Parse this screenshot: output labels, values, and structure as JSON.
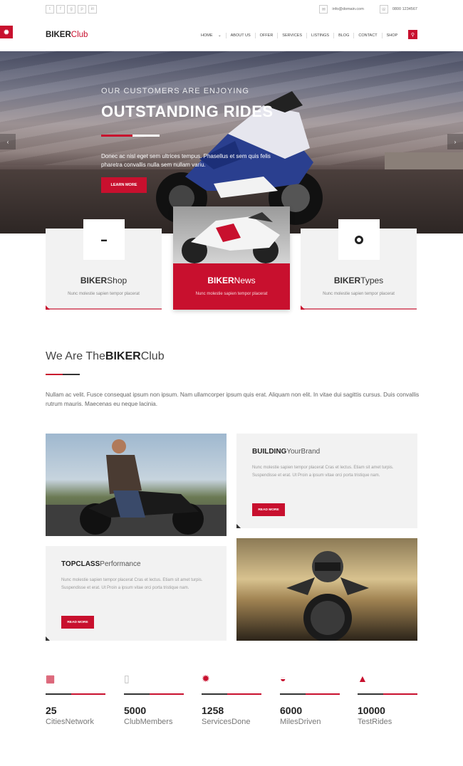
{
  "topbar": {
    "social_icons": [
      "twitter-icon",
      "facebook-icon",
      "google-plus-icon",
      "pinterest-icon",
      "linkedin-icon"
    ],
    "social_glyphs": [
      "t",
      "f",
      "g",
      "p",
      "in"
    ],
    "email": "info@domain.com",
    "phone": "0800 1234567"
  },
  "header": {
    "logo_bold": "BIKER",
    "logo_light": "Club",
    "nav": [
      "HOME",
      "ABOUT US",
      "OFFER",
      "SERVICES",
      "LISTINGS",
      "BLOG",
      "CONTACT",
      "SHOP"
    ]
  },
  "hero": {
    "subtitle": "OUR CUSTOMERS ARE ENJOYING",
    "title": "OUTSTANDING RIDES",
    "text": "Donec ac nisl eget sem ultrices tempus. Phasellus et sem quis felis pharetra convallis nulla sem nullam variu.",
    "button": "LEARN MORE"
  },
  "cards": [
    {
      "title_bold": "BIKER",
      "title_light": "Shop",
      "desc": "Nunc molestie sapien tempor placerat"
    },
    {
      "title_bold": "BIKER",
      "title_light": "News",
      "desc": "Nunc molestie sapien tempor placerat"
    },
    {
      "title_bold": "BIKER",
      "title_light": "Types",
      "desc": "Nunc molestie sapien tempor placerat"
    }
  ],
  "about": {
    "title_light": "We Are The",
    "title_bold": "BIKER",
    "title_end": "Club",
    "text": "Nullam ac velit. Fusce consequat ipsum non ipsum. Nam ullamcorper ipsum quis erat. Aliquam non elit. In vitae dui sagittis cursus. Duis convallis rutrum mauris. Maecenas eu neque lacinia."
  },
  "features": [
    {
      "title_bold": "BUILDING",
      "title_light": "YourBrand",
      "text": "Nunc molestie sapien tempor placerat Cras et lectus. Etiam sit amet turpis. Suspendisse et erat. Ut Proin a ipsum vitae orci porta tristique nam.",
      "button": "READ MORE"
    },
    {
      "title_bold": "TOPCLASS",
      "title_light": "Performance",
      "text": "Nunc molestie sapien tempor placerat Cras et lectus. Etiam sit amet turpis. Suspendisse et erat. Ut Proin a ipsum vitae orci porta tristique nam.",
      "button": "READ MORE"
    }
  ],
  "stats": [
    {
      "icon": "building-icon",
      "glyph": "▦",
      "number": "25",
      "label": "CitiesNetwork"
    },
    {
      "icon": "phone-icon",
      "glyph": "▯",
      "number": "5000",
      "label": "ClubMembers"
    },
    {
      "icon": "gear-icon",
      "glyph": "✹",
      "number": "1258",
      "label": "ServicesDone"
    },
    {
      "icon": "speedometer-icon",
      "glyph": "◒",
      "number": "6000",
      "label": "MilesDriven"
    },
    {
      "icon": "road-icon",
      "glyph": "▲",
      "number": "10000",
      "label": "TestRides"
    }
  ],
  "colors": {
    "accent": "#c8102e",
    "dark": "#222222",
    "panel": "#f2f2f2"
  }
}
